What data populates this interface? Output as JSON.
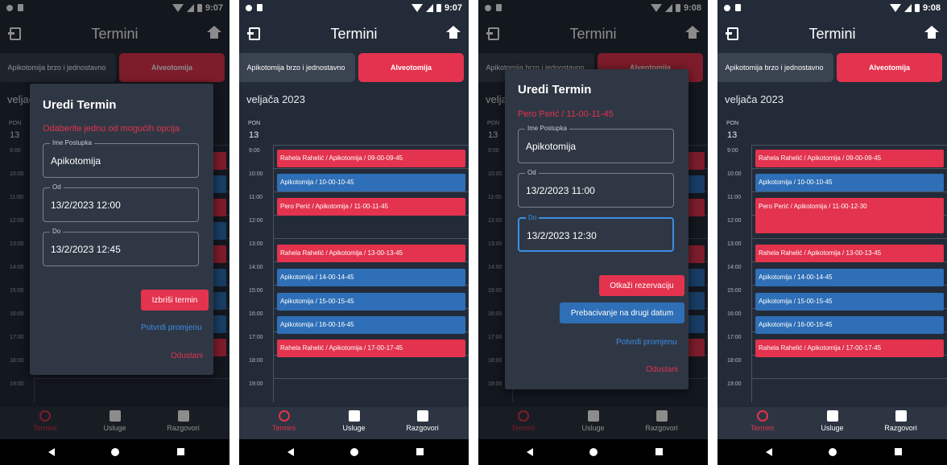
{
  "screens": [
    {
      "status_time": "9:07",
      "appbar_title": "Termini",
      "tabs": [
        "Apikotomija brzo i jednostavno",
        "Alveotomija"
      ],
      "month": "veljača 2023",
      "day_name": "PON",
      "day_num": "13",
      "dimmed": true,
      "dialog": {
        "title": "Uredi Termin",
        "subtitle": "Odaberite jednu od mogućih opcija",
        "fields": [
          {
            "label": "Ime Postupka",
            "value": "Apikotomija"
          },
          {
            "label": "Od",
            "value": "13/2/2023 12:00"
          },
          {
            "label": "Do",
            "value": "13/2/2023 12:45"
          }
        ],
        "delete_label": "Izbriši termin",
        "confirm_label": "Potvrdi promjenu",
        "cancel_label": "Odustani"
      }
    },
    {
      "status_time": "9:07",
      "appbar_title": "Termini",
      "tabs": [
        "Apikotomija brzo i jednostavno",
        "Alveotomija"
      ],
      "month": "veljača 2023",
      "day_name": "PON",
      "day_num": "13",
      "dimmed": false,
      "events": [
        {
          "text": "Rahela Rahelić / Apikotomija / 09-00-09-45",
          "color": "red"
        },
        {
          "text": "Apikotomija / 10-00-10-45",
          "color": "blue"
        },
        {
          "text": "Pero Perić / Apikotomija / 11-00-11-45",
          "color": "red"
        },
        {
          "text": "Rahela Rahelić / Apikotomija / 13-00-13-45",
          "color": "red"
        },
        {
          "text": "Apikotomija / 14-00-14-45",
          "color": "blue"
        },
        {
          "text": "Apikotomija / 15-00-15-45",
          "color": "blue"
        },
        {
          "text": "Apikotomija / 16-00-16-45",
          "color": "blue"
        },
        {
          "text": "Rahela Rahelić / Apikotomija / 17-00-17-45",
          "color": "red"
        }
      ]
    },
    {
      "status_time": "9:08",
      "appbar_title": "Termini",
      "tabs": [
        "Apikotomija brzo i jednostavno",
        "Alveotomija"
      ],
      "month": "veljača 2023",
      "day_name": "PON",
      "day_num": "13",
      "dimmed": true,
      "dialog": {
        "title": "Uredi Termin",
        "subtitle": "Pero Perić / 11-00-11-45",
        "fields": [
          {
            "label": "Ime Postupka",
            "value": "Apikotomija"
          },
          {
            "label": "Od",
            "value": "13/2/2023 11:00"
          },
          {
            "label": "Do",
            "value": "13/2/2023 12:30"
          }
        ],
        "cancel_reservation_label": "Otkaži rezervaciju",
        "move_label": "Prebacivanje na drugi datum",
        "confirm_label": "Potvrdi promjenu",
        "cancel_label": "Odustani"
      }
    },
    {
      "status_time": "9:08",
      "appbar_title": "Termini",
      "tabs": [
        "Apikotomija brzo i jednostavno",
        "Alveotomija"
      ],
      "month": "veljača 2023",
      "day_name": "PON",
      "day_num": "13",
      "dimmed": false,
      "events": [
        {
          "text": "Rahela Rahelić / Apikotomija / 09-00-09-45",
          "color": "red"
        },
        {
          "text": "Apikotomija / 10-00-10-45",
          "color": "blue"
        },
        {
          "text": "Pero Perić / Apikotomija / 11-00-12-30",
          "color": "red"
        },
        {
          "text": "Rahela Rahelić / Apikotomija / 13-00-13-45",
          "color": "red"
        },
        {
          "text": "Apikotomija / 14-00-14-45",
          "color": "blue"
        },
        {
          "text": "Apikotomija / 15-00-15-45",
          "color": "blue"
        },
        {
          "text": "Apikotomija / 16-00-16-45",
          "color": "blue"
        },
        {
          "text": "Rahela Rahelić / Apikotomija / 17-00-17-45",
          "color": "red"
        }
      ]
    }
  ],
  "hours": [
    "9:00",
    "10:00",
    "11:00",
    "12:00",
    "13:00",
    "14:00",
    "15:00",
    "16:00",
    "17:00",
    "18:00",
    "19:00"
  ],
  "bottom_nav": [
    "Termini",
    "Usluge",
    "Razgovori"
  ],
  "colors": {
    "accent_red": "#e3334e",
    "accent_blue": "#2e6fb7",
    "background": "#232b38"
  }
}
